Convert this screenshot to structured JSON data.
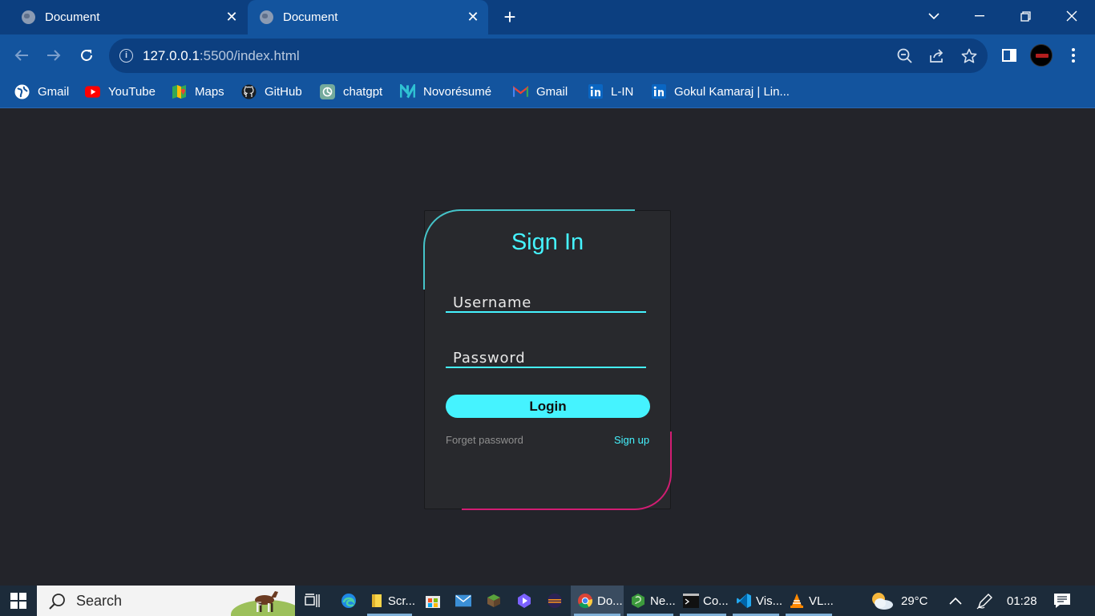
{
  "browser": {
    "tabs": [
      {
        "title": "Document",
        "active": false
      },
      {
        "title": "Document",
        "active": true
      }
    ],
    "url_host": "127.0.0.1",
    "url_rest": ":5500/index.html",
    "bookmarks": [
      {
        "label": "Gmail",
        "icon": "globe-icon"
      },
      {
        "label": "YouTube",
        "icon": "youtube-icon"
      },
      {
        "label": "Maps",
        "icon": "maps-icon"
      },
      {
        "label": "GitHub",
        "icon": "github-icon"
      },
      {
        "label": "chatgpt",
        "icon": "chatgpt-icon"
      },
      {
        "label": "Novorésumé",
        "icon": "novoresume-icon"
      },
      {
        "label": "Gmail",
        "icon": "gmail-icon"
      },
      {
        "label": "L-IN",
        "icon": "linkedin-icon"
      },
      {
        "label": "Gokul Kamaraj | Lin...",
        "icon": "linkedin-icon"
      }
    ]
  },
  "login": {
    "title": "Sign In",
    "username_label": "Username",
    "password_label": "Password",
    "login_label": "Login",
    "forget_label": "Forget password",
    "signup_label": "Sign up"
  },
  "taskbar": {
    "search_label": "Search",
    "apps": [
      {
        "label": "Scr..."
      },
      {
        "label": "Do..."
      },
      {
        "label": "Ne..."
      },
      {
        "label": "Co..."
      },
      {
        "label": "Vis..."
      },
      {
        "label": "VL..."
      }
    ],
    "temperature": "29°C",
    "time": "01:28"
  },
  "colors": {
    "accent_cyan": "#45f3ff",
    "accent_pink": "#d21d73",
    "page_bg": "#23242a",
    "chrome_blue": "#13549e"
  }
}
